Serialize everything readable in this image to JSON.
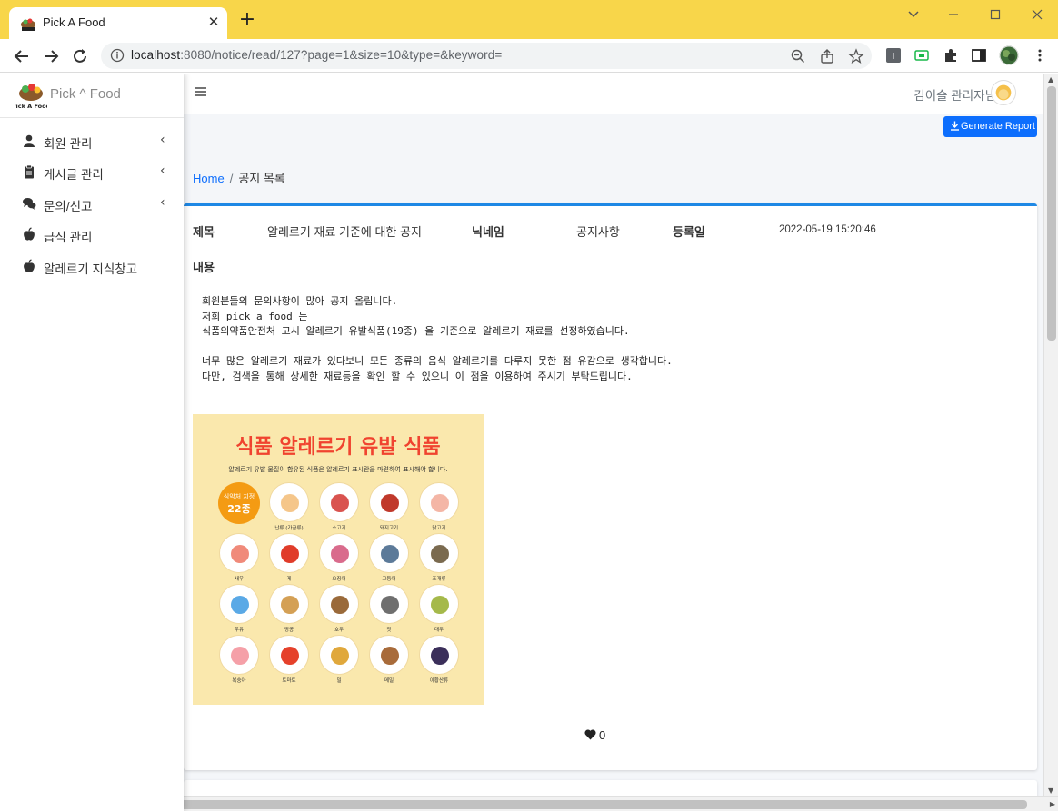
{
  "browser": {
    "tab_title": "Pick A Food",
    "url_host": "localhost",
    "url_rest": ":8080/notice/read/127?page=1&size=10&type=&keyword=",
    "accent": "#f8d64a"
  },
  "sidebar": {
    "brand": "Pick ^ Food",
    "items": [
      {
        "label": "회원 관리",
        "icon": "user-icon",
        "has_submenu": true
      },
      {
        "label": "게시글 관리",
        "icon": "clipboard-icon",
        "has_submenu": true
      },
      {
        "label": "문의/신고",
        "icon": "comments-icon",
        "has_submenu": true
      },
      {
        "label": "급식 관리",
        "icon": "apple-icon",
        "has_submenu": false
      },
      {
        "label": "알레르기 지식창고",
        "icon": "apple-icon",
        "has_submenu": false
      }
    ]
  },
  "header": {
    "user_name": "김이슬 관리자님"
  },
  "report_button": "Generate Report",
  "breadcrumb": {
    "home": "Home",
    "separator": "/",
    "current": "공지 목록"
  },
  "notice": {
    "title_label": "제목",
    "title_value": "알레르기 재료 기준에 대한 공지",
    "nickname_label": "닉네임",
    "nickname_value": "공지사항",
    "date_label": "등록일",
    "date_value": "2022-05-19 15:20:46",
    "content_label": "내용",
    "content": "회원분들의 문의사항이 많아 공지 올립니다.\n저희 pick a food 는\n식품의약품안전처 고시 알레르기 유발식품(19종) 을 기준으로 알레르기 재료를 선정하였습니다.\n\n너무 많은 알레르기 재료가 있다보니 모든 종류의 음식 알레르기를 다루지 못한 점 유감으로 생각합니다.\n다만, 검색을 통해 상세한 재료등을 확인 할 수 있으니 이 점을 이용하여 주시기 부탁드립니다.",
    "likes": "0"
  },
  "allergy_image": {
    "title": "식품 알레르기 유발 식품",
    "subtitle": "알레르기 유발 물질이 함유된 식품은 알레르기 표시란을 마련하여 표시해야 합니다.",
    "badge_line1": "식약처 지정",
    "badge_line2": "22종",
    "items": [
      {
        "label": "난류 (가금류)",
        "color": "#f5c68a"
      },
      {
        "label": "소고기",
        "color": "#d9534f"
      },
      {
        "label": "돼지고기",
        "color": "#c0392b"
      },
      {
        "label": "닭고기",
        "color": "#f4b6a6"
      },
      {
        "label": "새우",
        "color": "#f08a7a"
      },
      {
        "label": "게",
        "color": "#e03c2a"
      },
      {
        "label": "오징어",
        "color": "#d96b8c"
      },
      {
        "label": "고등어",
        "color": "#5c7a99"
      },
      {
        "label": "조개류",
        "color": "#7a6a4f"
      },
      {
        "label": "우유",
        "color": "#5aa9e6"
      },
      {
        "label": "땅콩",
        "color": "#d4a055"
      },
      {
        "label": "호두",
        "color": "#9a6a3a"
      },
      {
        "label": "잣",
        "color": "#6f6f6f"
      },
      {
        "label": "대두",
        "color": "#a5b94a"
      },
      {
        "label": "복숭아",
        "color": "#f5a0a8"
      },
      {
        "label": "토마토",
        "color": "#e5412b"
      },
      {
        "label": "밀",
        "color": "#e0a83c"
      },
      {
        "label": "메밀",
        "color": "#a86b3a"
      },
      {
        "label": "아황산류",
        "color": "#3b2f5a"
      }
    ]
  }
}
